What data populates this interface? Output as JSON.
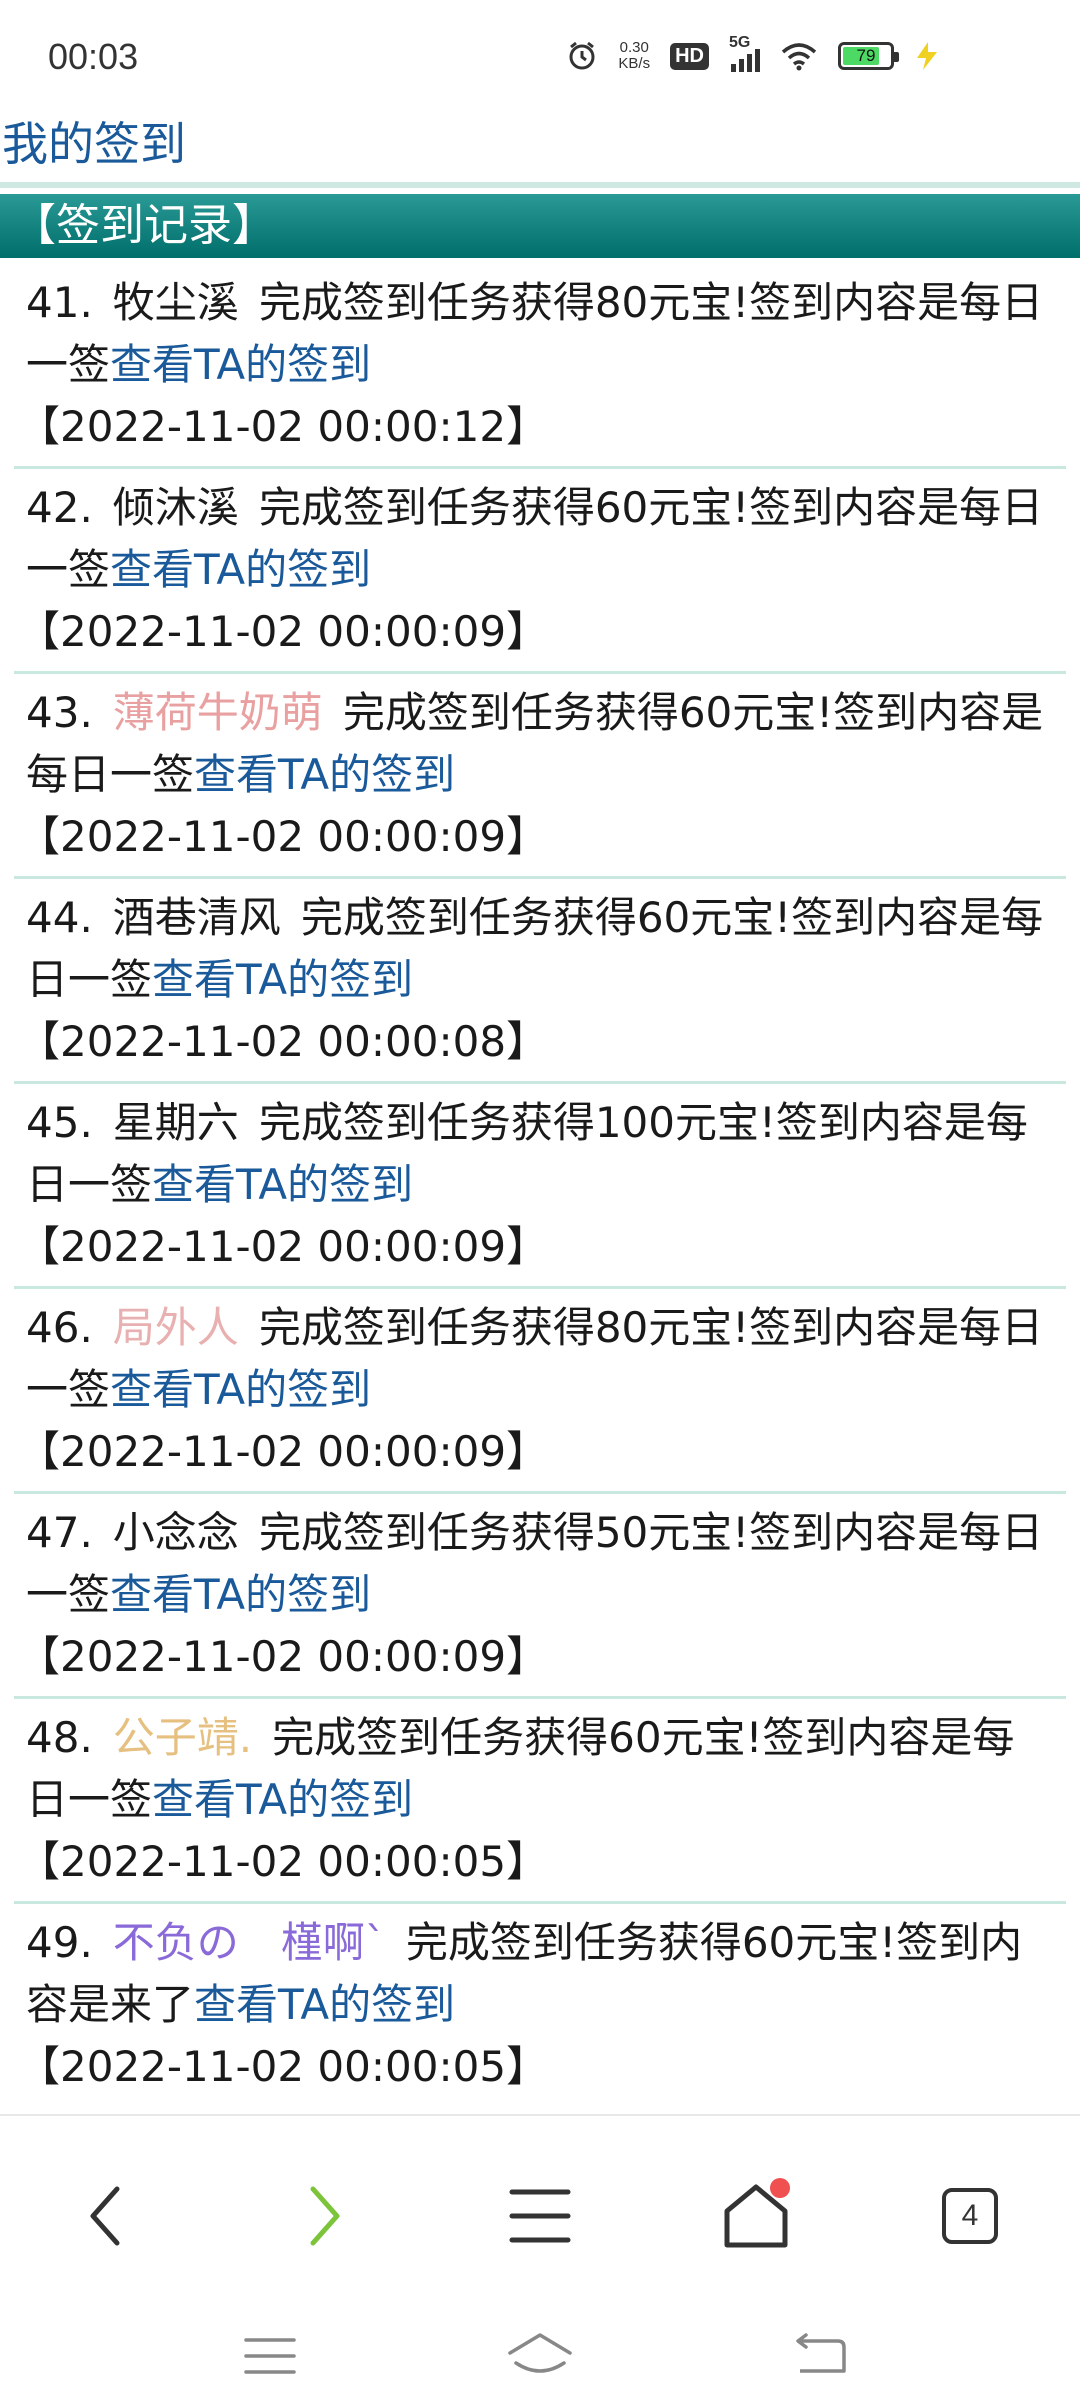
{
  "status": {
    "time": "00:03",
    "net_speed_value": "0.30",
    "net_speed_unit": "KB/s",
    "hd_label": "HD",
    "network_label": "5G",
    "battery_level": "79",
    "battery_fraction": 0.79
  },
  "page": {
    "title": "我的签到",
    "section_header": "【签到记录】"
  },
  "records": [
    {
      "num": "41.",
      "name": "牧尘溪",
      "name_color": "#1a1a1a",
      "msg": "完成签到任务获得80元宝!签到内容是每日一签",
      "link": "查看TA的签到",
      "time": "【2022-11-02 00:00:12】"
    },
    {
      "num": "42.",
      "name": "倾沐溪",
      "name_color": "#1a1a1a",
      "msg": "完成签到任务获得60元宝!签到内容是每日一签",
      "link": "查看TA的签到",
      "time": "【2022-11-02 00:00:09】"
    },
    {
      "num": "43.",
      "name": "薄荷牛奶萌",
      "name_color": "#e9a0a0",
      "msg": "完成签到任务获得60元宝!签到内容是每日一签",
      "link": "查看TA的签到",
      "time": "【2022-11-02 00:00:09】"
    },
    {
      "num": "44.",
      "name": "酒巷清风",
      "name_color": "#1a1a1a",
      "msg": "完成签到任务获得60元宝!签到内容是每日一签",
      "link": "查看TA的签到",
      "time": "【2022-11-02 00:00:08】"
    },
    {
      "num": "45.",
      "name": "星期六",
      "name_color": "#1a1a1a",
      "msg": "完成签到任务获得100元宝!签到内容是每日一签",
      "link": "查看TA的签到",
      "time": "【2022-11-02 00:00:09】"
    },
    {
      "num": "46.",
      "name": "局外人",
      "name_color": "#e8b0b0",
      "msg": "完成签到任务获得80元宝!签到内容是每日一签",
      "link": "查看TA的签到",
      "time": "【2022-11-02 00:00:09】"
    },
    {
      "num": "47.",
      "name": "小念念",
      "name_color": "#1a1a1a",
      "msg": "完成签到任务获得50元宝!签到内容是每日一签",
      "link": "查看TA的签到",
      "time": "【2022-11-02 00:00:09】"
    },
    {
      "num": "48.",
      "name": "公子靖.",
      "name_color": "#e6c080",
      "msg": "完成签到任务获得60元宝!签到内容是每日一签",
      "link": "查看TA的签到",
      "time": "【2022-11-02 00:00:05】"
    },
    {
      "num": "49.",
      "name": "不负の　槿啊ˋ",
      "name_color": "#8a6ad8",
      "msg": "完成签到任务获得60元宝!签到内容是来了",
      "link": "查看TA的签到",
      "time": "【2022-11-02 00:00:05】"
    }
  ],
  "nav": {
    "tab_count": "4",
    "icons": [
      "back-icon",
      "forward-icon",
      "menu-icon",
      "home-icon",
      "tabs-icon"
    ],
    "accent_color": "#7cc43a",
    "badge_color": "#f05050"
  },
  "system_nav": {
    "icons": [
      "recents-icon",
      "home-icon",
      "back-icon"
    ]
  }
}
